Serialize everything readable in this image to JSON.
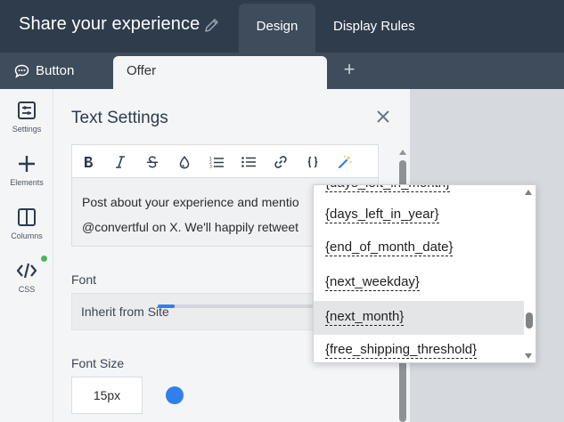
{
  "header": {
    "title": "Share your experience",
    "tabs": [
      {
        "label": "Design",
        "active": true
      },
      {
        "label": "Display Rules",
        "active": false
      }
    ]
  },
  "subtabs": {
    "items": [
      {
        "label": "Button",
        "icon": "chat-bubble-icon"
      },
      {
        "label": "Offer",
        "active": true
      }
    ],
    "add_label": "+"
  },
  "sidebar": {
    "items": [
      {
        "label": "Settings",
        "icon": "settings-icon"
      },
      {
        "label": "Elements",
        "icon": "plus-icon"
      },
      {
        "label": "Columns",
        "icon": "columns-icon"
      },
      {
        "label": "CSS",
        "icon": "code-icon",
        "status": "active-dot"
      }
    ]
  },
  "panel": {
    "title": "Text Settings",
    "editor": {
      "toolbar": [
        "bold",
        "italic",
        "strikethrough",
        "color",
        "ordered-list",
        "bullet-list",
        "link",
        "placeholder-braces",
        "magic-wand"
      ],
      "text": "Post about your experience and mentio\n@convertful on X. We'll happily retweet"
    },
    "font": {
      "label": "Font",
      "value": "Inherit from Site"
    },
    "font_size": {
      "label": "Font Size",
      "value": "15px",
      "slider_fraction": 0.08
    }
  },
  "dropdown": {
    "partial_top": "{days_left_in_month}",
    "items": [
      "{days_left_in_year}",
      "{end_of_month_date}",
      "{next_weekday}",
      "{next_month}",
      "{free_shipping_threshold}"
    ],
    "highlighted_index": 3
  },
  "colors": {
    "header_bg": "#2e3c4c",
    "active_tab_bg": "#3e4c5c",
    "panel_bg": "#f4f5f7",
    "accent": "#2f80ed",
    "status_dot": "#4cb35a"
  }
}
